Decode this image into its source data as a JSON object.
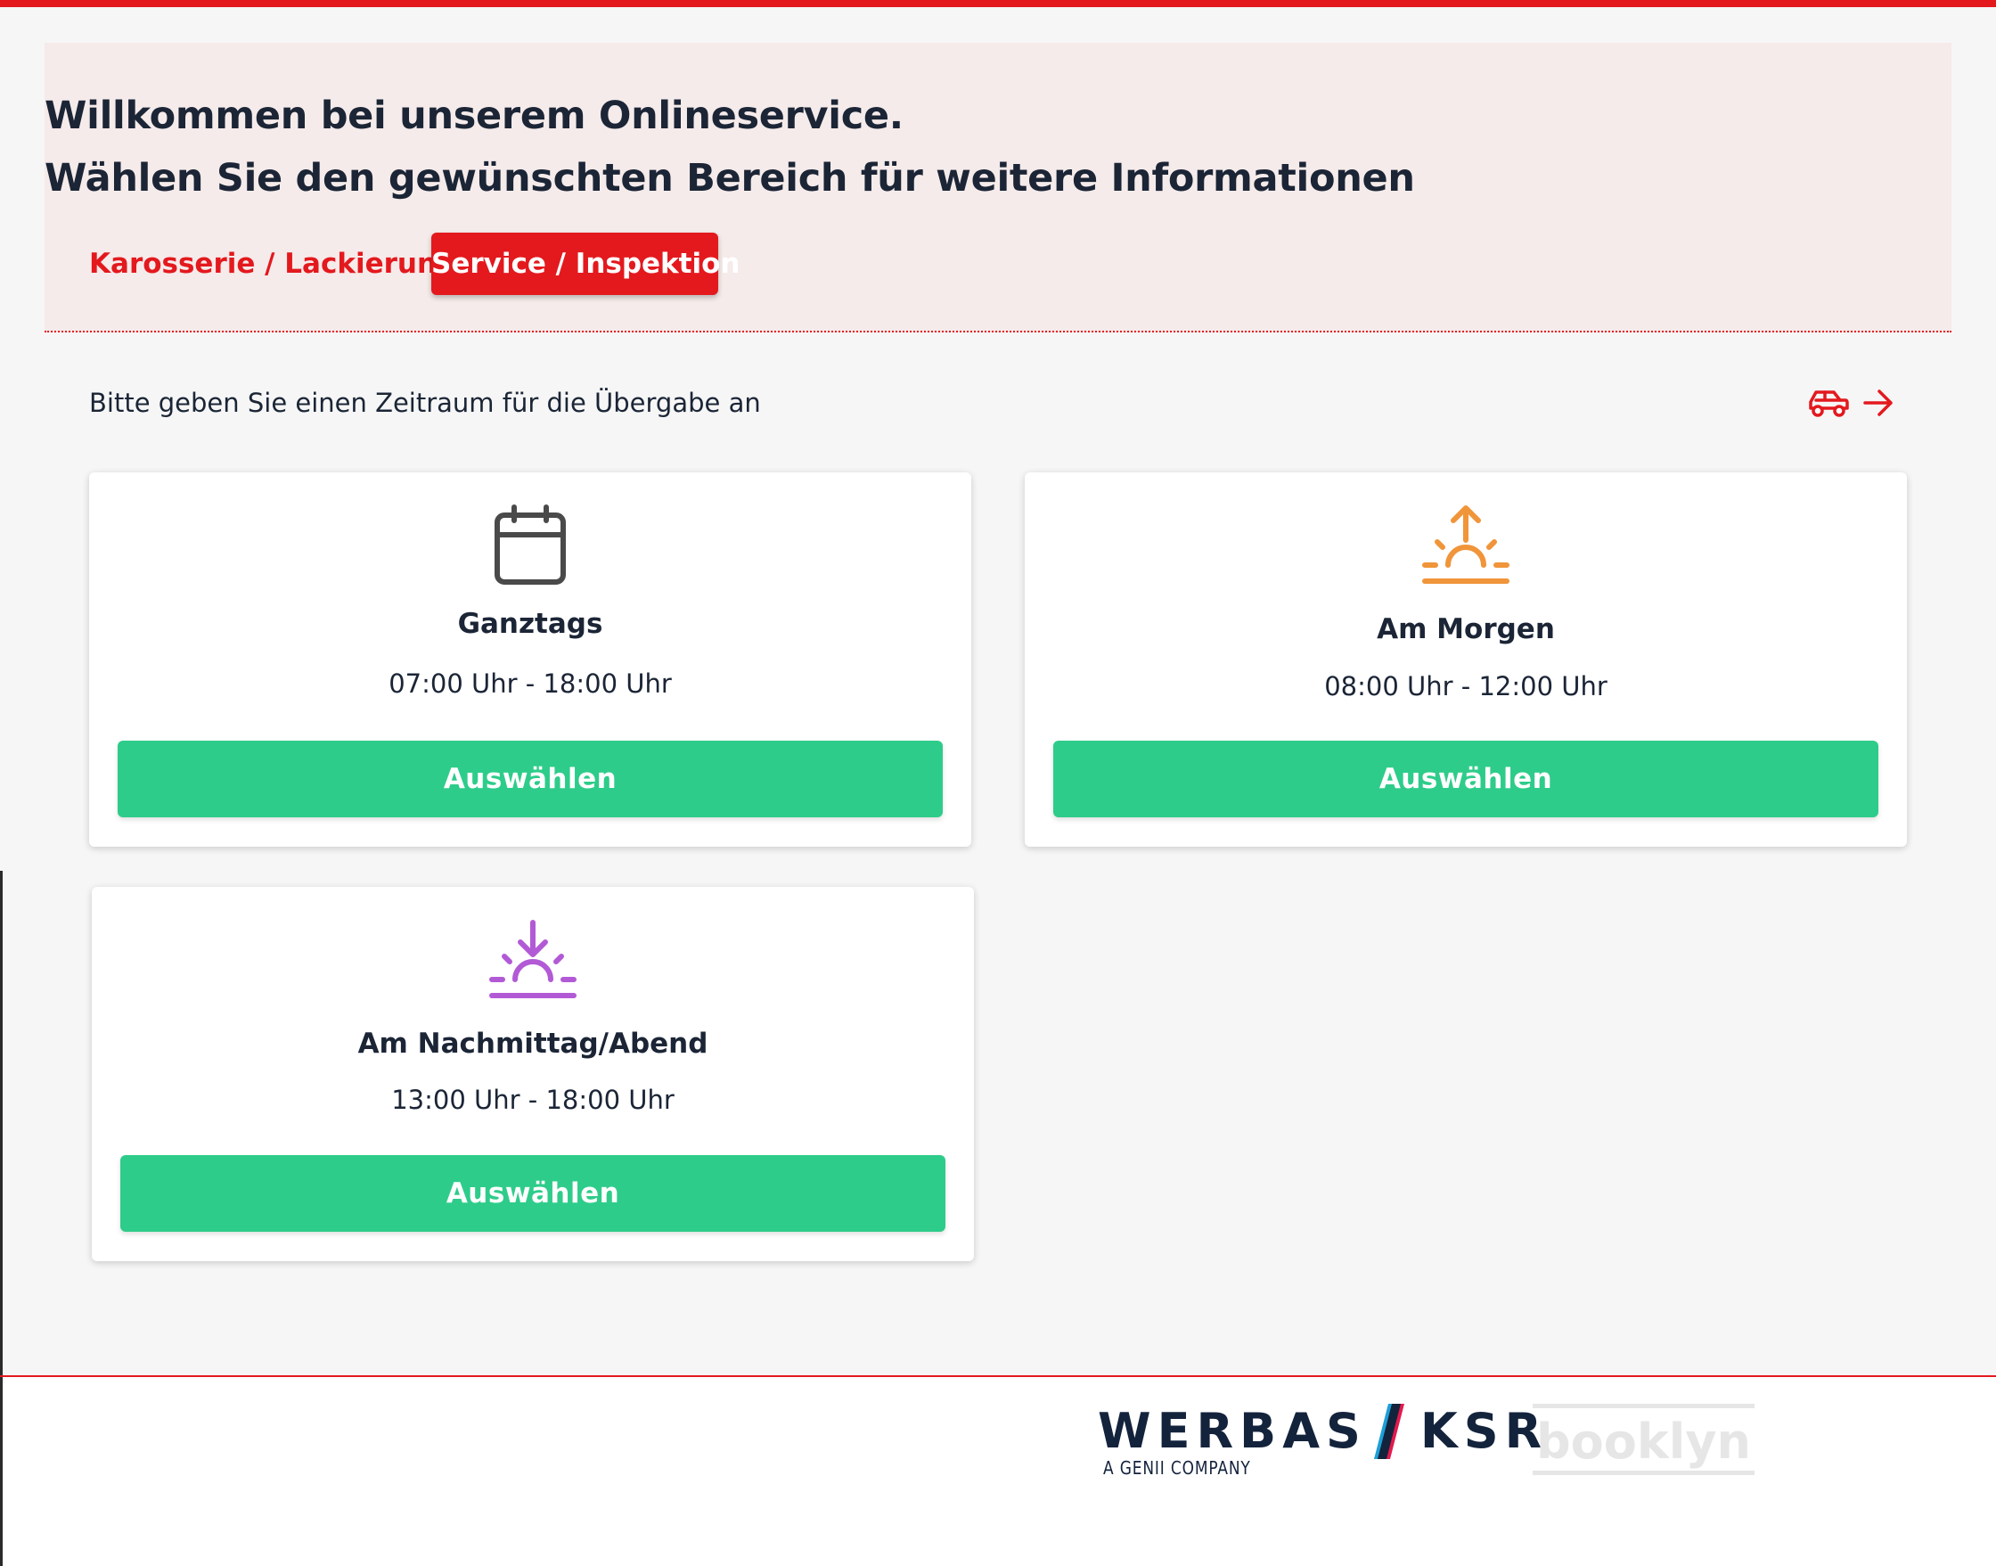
{
  "header": {
    "welcome_line": "Willkommen bei unserem Onlineservice.",
    "choose_line": "Wählen Sie den gewünschten Bereich für weitere Informationen"
  },
  "tabs": [
    {
      "label": "Karosserie / Lackierung",
      "active": false
    },
    {
      "label": "Service / Inspektion",
      "active": true
    }
  ],
  "main": {
    "subtitle": "Bitte geben Sie einen Zeitraum für die Übergabe an",
    "nav_icons": [
      "car-icon",
      "arrow-right-icon"
    ],
    "options": [
      {
        "icon": "calendar-icon",
        "title": "Ganztags",
        "time": "07:00 Uhr - 18:00 Uhr",
        "button": "Auswählen",
        "icon_color": "#4a4a4a"
      },
      {
        "icon": "sunrise-icon",
        "title": "Am Morgen",
        "time": "08:00 Uhr - 12:00 Uhr",
        "button": "Auswählen",
        "icon_color": "#f0953a"
      },
      {
        "icon": "sunset-icon",
        "title": "Am Nachmittag/Abend",
        "time": "13:00 Uhr - 18:00 Uhr",
        "button": "Auswählen",
        "icon_color": "#b25ad6"
      }
    ]
  },
  "footer": {
    "logo_werbas": "WERBAS",
    "logo_ksr": "KSR",
    "logo_tagline": "A GENII COMPANY",
    "logo_booklyn": "booklyn"
  },
  "colors": {
    "accent": "#e3191e",
    "button": "#2ecc8a",
    "hero_bg": "#f5ebea",
    "text": "#1b2536"
  }
}
